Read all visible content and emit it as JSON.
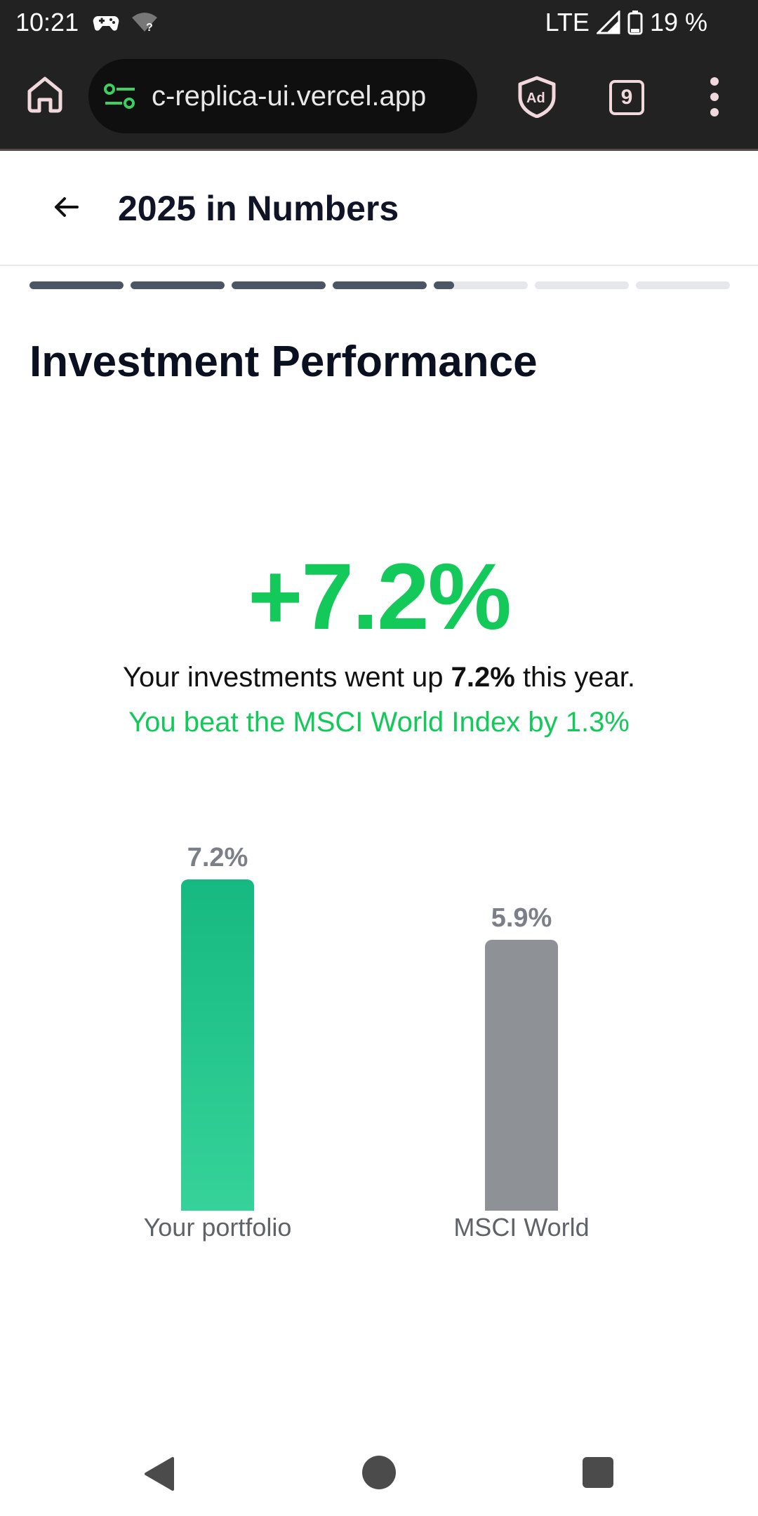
{
  "status_bar": {
    "time": "10:21",
    "network": "LTE",
    "battery": "19 %",
    "icons": [
      "game-controller-icon",
      "wifi-question-icon",
      "signal-icon",
      "battery-icon"
    ]
  },
  "browser": {
    "url": "c-replica-ui.vercel.app",
    "tab_count": "9",
    "icons": [
      "home-icon",
      "site-settings-icon",
      "adblock-shield-icon",
      "more-vert-icon"
    ]
  },
  "header": {
    "title": "2025 in Numbers",
    "back_icon": "arrow-back-icon"
  },
  "progress": {
    "segments": [
      1,
      1,
      1,
      1,
      0.22,
      0,
      0
    ]
  },
  "section": {
    "title": "Investment Performance"
  },
  "summary": {
    "headline": "+7.2%",
    "sentence_prefix": "Your investments went up ",
    "sentence_value": "7.2%",
    "sentence_suffix": " this year.",
    "comparison": "You beat the MSCI World Index by 1.3%"
  },
  "chart_data": {
    "type": "bar",
    "categories": [
      "Your portfolio",
      "MSCI World"
    ],
    "values": [
      7.2,
      5.9
    ],
    "value_labels": [
      "7.2%",
      "5.9%"
    ],
    "unit": "%",
    "colors": [
      "#16b981",
      "#8e9196"
    ],
    "title": "",
    "xlabel": "",
    "ylabel": ""
  },
  "colors": {
    "accent_green": "#12c95a",
    "dark": "#0b1020",
    "bar_portfolio_top": "#16b981",
    "bar_portfolio_bottom": "#35d39a",
    "bar_msci": "#8e9196"
  },
  "nav": {
    "icons": [
      "nav-back-icon",
      "nav-home-icon",
      "nav-recents-icon"
    ]
  }
}
